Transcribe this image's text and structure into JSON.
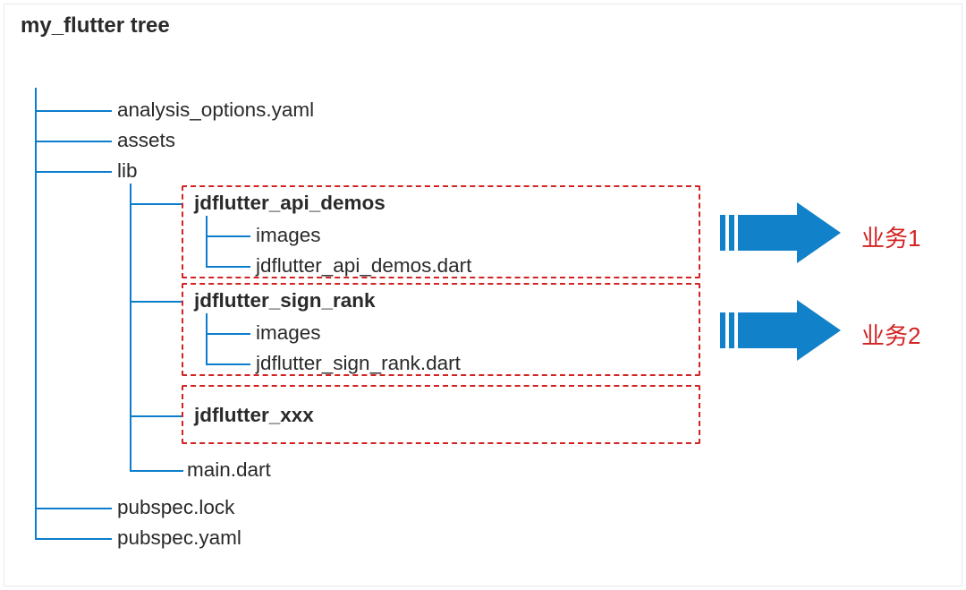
{
  "title": "my_flutter tree",
  "tree": {
    "root": "my_flutter",
    "items": [
      "analysis_options.yaml",
      "assets",
      "lib",
      "pubspec.lock",
      "pubspec.yaml"
    ],
    "lib": {
      "modules": [
        {
          "name": "jdflutter_api_demos",
          "children": [
            "images",
            "jdflutter_api_demos.dart"
          ]
        },
        {
          "name": "jdflutter_sign_rank",
          "children": [
            "images",
            "jdflutter_sign_rank.dart"
          ]
        },
        {
          "name": "jdflutter_xxx",
          "children": []
        }
      ],
      "tail": "main.dart"
    }
  },
  "callouts": [
    "业务1",
    "业务2"
  ],
  "colors": {
    "tree_line": "#0b7dcc",
    "arrow_fill": "#1181c9",
    "dash_border": "#d32222",
    "label_text": "#d32222"
  }
}
